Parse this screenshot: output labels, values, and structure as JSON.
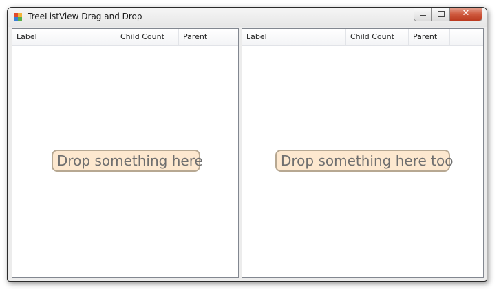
{
  "window": {
    "title": "TreeListView Drag and Drop",
    "caption_buttons": [
      "minimize",
      "maximize",
      "close"
    ],
    "close_glyph": "✕"
  },
  "left_panel": {
    "columns": [
      "Label",
      "Child Count",
      "Parent"
    ],
    "drop_hint": "Drop something here"
  },
  "right_panel": {
    "columns": [
      "Label",
      "Child Count",
      "Parent"
    ],
    "drop_hint": "Drop something here too"
  },
  "colors": {
    "drop_hint_bg": "#fde8cf",
    "drop_hint_border": "#b7a892",
    "close_button": "#cf5a3f"
  },
  "icons": [
    "app-icon",
    "minimize-icon",
    "maximize-icon",
    "close-icon"
  ]
}
